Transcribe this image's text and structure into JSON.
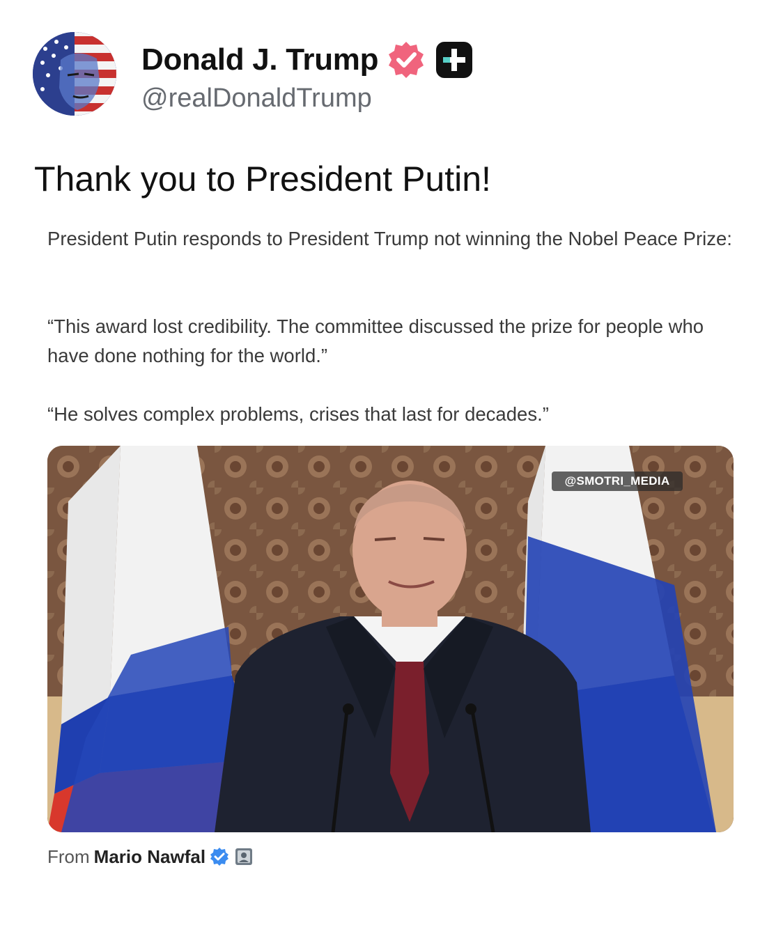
{
  "author": {
    "display_name": "Donald J. Trump",
    "handle": "@realDonaldTrump",
    "verified_icon": "verified-badge-icon",
    "extra_icon": "plus-badge-icon",
    "avatar_icon": "profile-avatar"
  },
  "post": {
    "text": "Thank you to President Putin!"
  },
  "quoted": {
    "paragraphs": [
      "President Putin responds to President Trump not winning the Nobel Peace Prize:",
      "“This award lost credibility. The committee discussed the prize for people who have done nothing for the world.”",
      "“He solves complex problems, crises that last for decades.”"
    ],
    "media_watermark": "@SMOTRI_MEDIA"
  },
  "attribution": {
    "prefix": "From",
    "name": "Mario Nawfal"
  },
  "colors": {
    "verified_badge": "#f0647d",
    "blue_verified": "#3b8cf0",
    "flag_white": "#f2f2f2",
    "flag_blue": "#1f3fb0",
    "flag_red": "#d8382c"
  }
}
